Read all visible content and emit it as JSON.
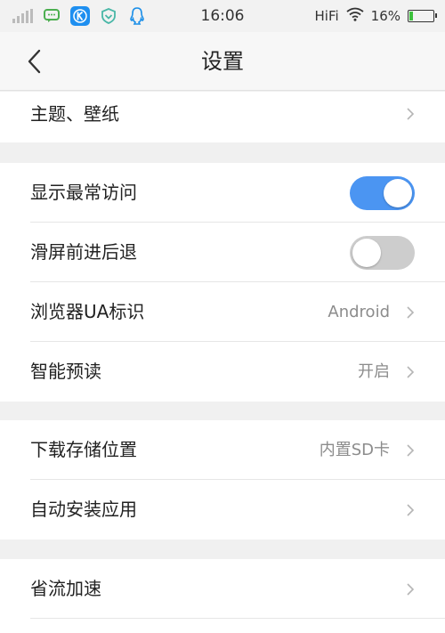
{
  "status_bar": {
    "time": "16:06",
    "network_label": "HiFi",
    "battery": "16%",
    "battery_level": 0.16,
    "icons": [
      "signal-icon",
      "message-icon",
      "kugou-icon",
      "shield-icon",
      "qq-icon",
      "wifi-icon",
      "battery-icon"
    ]
  },
  "nav": {
    "title": "设置"
  },
  "colors": {
    "accent": "#4b95f2",
    "toggle_off": "#cdcdcd",
    "background": "#f0f0f0"
  },
  "settings": {
    "theme": {
      "label": "主题、壁纸"
    },
    "show_most_visited": {
      "label": "显示最常访问",
      "enabled": true
    },
    "swipe_nav": {
      "label": "滑屏前进后退",
      "enabled": false
    },
    "ua": {
      "label": "浏览器UA标识",
      "value": "Android"
    },
    "preload": {
      "label": "智能预读",
      "value": "开启"
    },
    "download_location": {
      "label": "下载存储位置",
      "value": "内置SD卡"
    },
    "auto_install": {
      "label": "自动安装应用"
    },
    "data_saver": {
      "label": "省流加速"
    }
  }
}
